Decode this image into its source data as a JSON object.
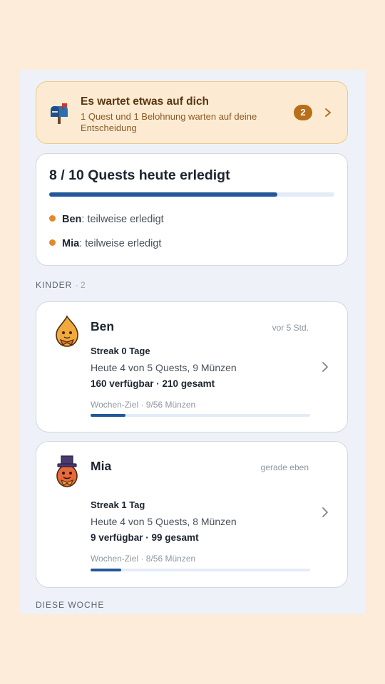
{
  "notice": {
    "title": "Es wartet etwas auf dich",
    "subtitle": "1 Quest und 1 Belohnung warten auf deine Entscheidung",
    "badge": "2",
    "icon": "mailbox-icon"
  },
  "summary": {
    "title": "8 / 10 Quests heute erledigt",
    "progress": 0.8,
    "kids": [
      {
        "name": "Ben",
        "status": ": teilweise erledigt"
      },
      {
        "name": "Mia",
        "status": ": teilweise erledigt"
      }
    ]
  },
  "kids_section": {
    "label": "KINDER",
    "count": "· 2"
  },
  "kids": [
    {
      "name": "Ben",
      "time": "vor 5 Std.",
      "streak": "Streak 0 Tage",
      "today": "Heute 4 von 5 Quests, 9 Münzen",
      "coins": "160 verfügbar · 210 gesamt",
      "goal": "Wochen-Ziel · 9/56 Münzen",
      "goal_progress": 0.16,
      "avatar": "flame-avatar-icon"
    },
    {
      "name": "Mia",
      "time": "gerade eben",
      "streak": "Streak 1 Tag",
      "today": "Heute 4 von 5 Quests, 8 Münzen",
      "coins": "9 verfügbar · 99 gesamt",
      "goal": "Wochen-Ziel · 8/56 Münzen",
      "goal_progress": 0.14,
      "avatar": "egg-hat-avatar-icon"
    }
  ],
  "week_section": {
    "label": "DIESE WOCHE"
  },
  "colors": {
    "accent": "#22579a",
    "orange": "#e08a2c",
    "badge": "#b86f1c"
  }
}
